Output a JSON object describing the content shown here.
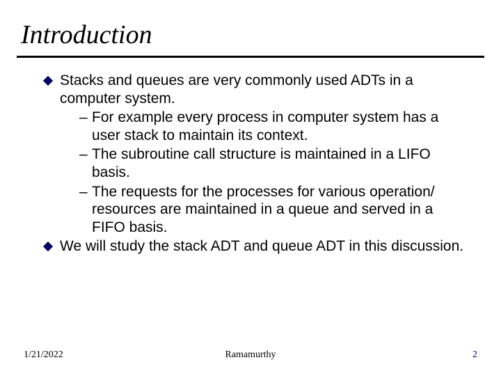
{
  "title": "Introduction",
  "bullets": [
    {
      "text": "Stacks and queues are very commonly used ADTs in a computer system.",
      "subs": [
        "For example every process in computer system has a user stack to maintain its context.",
        "The subroutine call structure is maintained in a LIFO basis.",
        "The requests for the processes for various operation/ resources are maintained in a queue and served in a FIFO basis."
      ]
    },
    {
      "text": "We will study the stack ADT and queue ADT in this discussion.",
      "subs": []
    }
  ],
  "footer": {
    "date": "1/21/2022",
    "author": "Ramamurthy",
    "page": "2"
  }
}
